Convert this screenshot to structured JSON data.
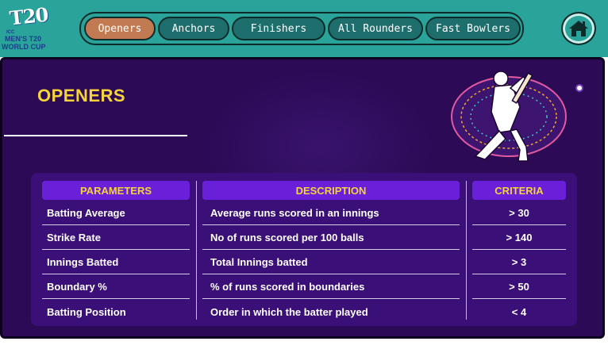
{
  "logo": {
    "mark": "T20",
    "icc": "ICC",
    "line1": "MEN'S T20",
    "line2": "WORLD CUP"
  },
  "tabs": [
    {
      "label": "Openers",
      "active": true
    },
    {
      "label": "Anchors",
      "active": false
    },
    {
      "label": "Finishers",
      "active": false
    },
    {
      "label": "All Rounders",
      "active": false
    },
    {
      "label": "Fast Bowlers",
      "active": false
    }
  ],
  "home": {
    "icon": "home-icon"
  },
  "section": {
    "title": "OPENERS"
  },
  "table": {
    "headers": {
      "parameters": "PARAMETERS",
      "description": "DESCRIPTION",
      "criteria": "CRITERIA"
    },
    "rows": [
      {
        "parameter": "Batting Average",
        "description": "Average runs scored in an innings",
        "criteria": "> 30"
      },
      {
        "parameter": "Strike Rate",
        "description": "No of runs scored per 100 balls",
        "criteria": "> 140"
      },
      {
        "parameter": "Innings Batted",
        "description": "Total Innings batted",
        "criteria": "> 3"
      },
      {
        "parameter": "Boundary %",
        "description": "% of runs scored in boundaries",
        "criteria": "> 50"
      },
      {
        "parameter": "Batting Position",
        "description": "Order in which the batter played",
        "criteria": "< 4"
      }
    ]
  },
  "colors": {
    "teal": "#2aa39a",
    "panel": "#2c0a55",
    "header_purple": "#6a1fd8",
    "accent_yellow": "#f5d43a",
    "active_tab": "#c27a52"
  }
}
